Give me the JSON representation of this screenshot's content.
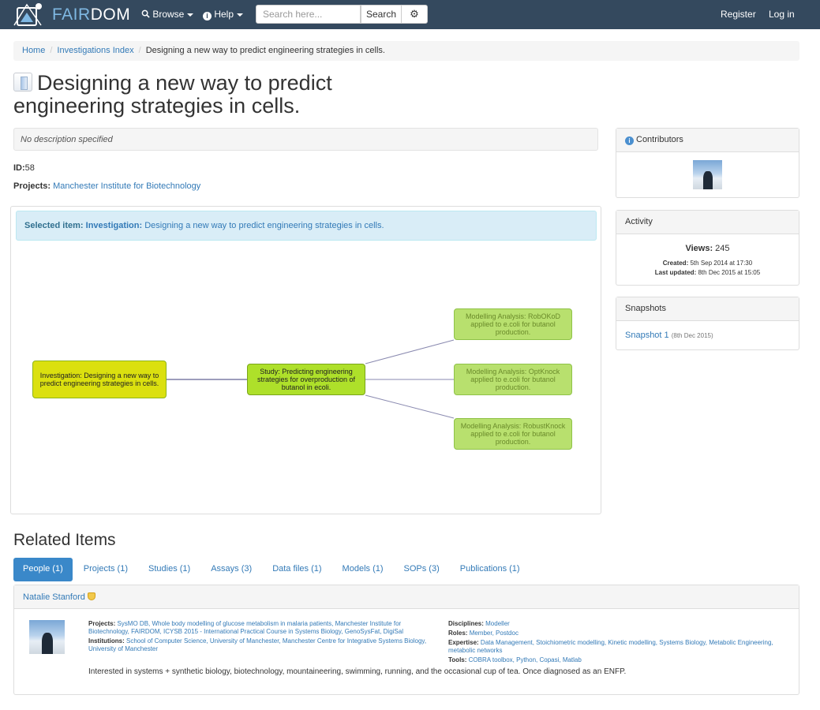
{
  "nav": {
    "brand_fair": "FAIR",
    "brand_dom": "DOM",
    "browse": "Browse",
    "help": "Help",
    "search_placeholder": "Search here...",
    "search_button": "Search",
    "register": "Register",
    "login": "Log in"
  },
  "breadcrumb": {
    "home": "Home",
    "index": "Investigations Index",
    "current": "Designing a new way to predict engineering strategies in cells."
  },
  "title": "Designing a new way to predict engineering strategies in cells.",
  "description": "No description specified",
  "meta": {
    "id_label": "ID:",
    "id_value": "58",
    "projects_label": "Projects:",
    "project": "Manchester Institute for Biotechnology"
  },
  "graph": {
    "selected_label": "Selected item:",
    "selected_type": "Investigation:",
    "selected_name": "Designing a new way to predict engineering strategies in cells.",
    "investigation_node": "Investigation: Designing a new way to predict engineering strategies in cells.",
    "study_node": "Study: Predicting engineering strategies for overproduction of butanol in ecoli.",
    "assays": [
      "Modelling Analysis: RobOKoD applied to e.coli for butanol production.",
      "Modelling Analysis: OptKnock applied to e.coli for butanol production.",
      "Modelling Analysis: RobustKnock applied to e.coli for butanol production."
    ]
  },
  "sidebar": {
    "contributors_title": "Contributors",
    "activity_title": "Activity",
    "views_label": "Views:",
    "views_value": "245",
    "created_label": "Created:",
    "created_value": "5th Sep 2014 at 17:30",
    "updated_label": "Last updated:",
    "updated_value": "8th Dec 2015 at 15:05",
    "snapshots_title": "Snapshots",
    "snapshot_link": "Snapshot 1",
    "snapshot_date": "(8th Dec 2015)"
  },
  "related": {
    "title": "Related Items",
    "tabs": [
      "People (1)",
      "Projects (1)",
      "Studies (1)",
      "Assays (3)",
      "Data files (1)",
      "Models (1)",
      "SOPs (3)",
      "Publications (1)"
    ],
    "person": {
      "name": "Natalie Stanford",
      "projects_label": "Projects:",
      "projects": "SysMO DB, Whole body modelling of glucose metabolism in malaria patients, Manchester Institute for Biotechnology, FAIRDOM, ICYSB 2015 - International Practical Course in Systems Biology, GenoSysFat, DigiSal",
      "institutions_label": "Institutions:",
      "institutions": "School of Computer Science, University of Manchester, Manchester Centre for Integrative Systems Biology, University of Manchester",
      "disciplines_label": "Disciplines:",
      "disciplines": "Modeller",
      "roles_label": "Roles:",
      "roles": "Member, Postdoc",
      "expertise_label": "Expertise:",
      "expertise": "Data Management, Stoichiometric modelling, Kinetic modelling, Systems Biology, Metabolic Engineering, metabolic networks",
      "tools_label": "Tools:",
      "tools": "COBRA toolbox, Python, Copasi, Matlab",
      "bio": "Interested in systems + synthetic biology, biotechnology, mountaineering, swimming, running, and the occasional cup of tea. Once diagnosed as an ENFP."
    }
  },
  "colors": {
    "navbar": "#34495e",
    "investigation_node": "#dbe00f",
    "study_node": "#aee02a",
    "assay_node": "#b8e06e",
    "active_tab": "#3a88c9"
  }
}
